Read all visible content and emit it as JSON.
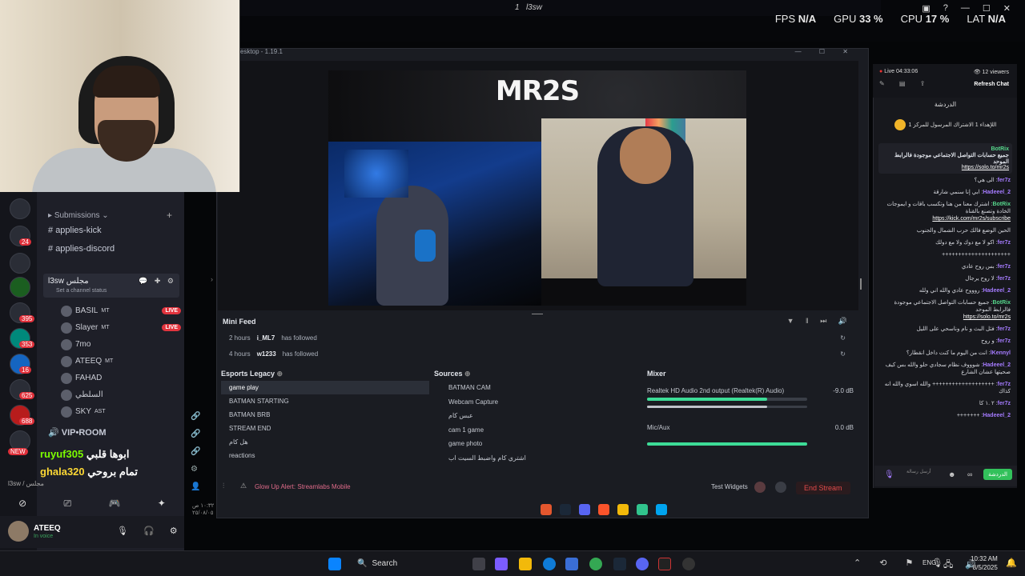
{
  "topbar": {
    "title": "l3sw",
    "tab_num": "1",
    "stats": {
      "fps_label": "FPS",
      "fps_value": "N/A",
      "gpu_label": "GPU",
      "gpu_value": "33 %",
      "cpu_label": "CPU",
      "cpu_value": "17 %",
      "lat_label": "LAT",
      "lat_value": "N/A"
    }
  },
  "discord": {
    "server_badges": [
      "24",
      "395",
      "353",
      "16",
      "625",
      "688",
      "NEW"
    ],
    "category": "Submissions",
    "channels": [
      "applies-kick",
      "applies-discord"
    ],
    "voice_channel": {
      "name": "l3sw مجلس",
      "status": "Set a channel status"
    },
    "voice_users": [
      {
        "name": "BASIL",
        "tag": "MT",
        "live": "LIVE"
      },
      {
        "name": "Slayer",
        "tag": "MT",
        "live": "LIVE"
      },
      {
        "name": "7mo",
        "tag": "",
        "live": ""
      },
      {
        "name": "ATEEQ",
        "tag": "MT",
        "live": ""
      },
      {
        "name": "FAHAD",
        "tag": "",
        "live": ""
      },
      {
        "name": "السلطي",
        "tag": "",
        "live": ""
      },
      {
        "name": "SKY",
        "tag": "AST",
        "live": ""
      }
    ],
    "vip_room": "VIP•ROOM",
    "voice_connected": "l3sw / مجلس",
    "user": {
      "name": "ATEEQ",
      "status": "In voice"
    }
  },
  "stream_overlay_chat": [
    {
      "name": "ruyuf305",
      "text": "ابوها قلبي"
    },
    {
      "name": "ghala320",
      "text": "تمام بروحي"
    }
  ],
  "streamlabs": {
    "window_title": "esktop - 1.19.1",
    "preview_title": "MR2S",
    "mini_feed": {
      "title": "Mini Feed",
      "rows": [
        {
          "time": "2 hours",
          "user": "i_ML7",
          "action": "has followed"
        },
        {
          "time": "4 hours",
          "user": "w1233",
          "action": "has followed"
        }
      ]
    },
    "scenes": {
      "title": "Esports Legacy",
      "items": [
        "game play",
        "BATMAN STARTING",
        "BATMAN BRB",
        "STREAM END",
        "هل كام",
        "reactions"
      ]
    },
    "sources": {
      "title": "Sources",
      "items": [
        "BATMAN CAM",
        "Webcam Capture",
        "عبس كام",
        "cam 1 game",
        "game photo",
        "اشتري كام واضبط السيت اب"
      ]
    },
    "mixer": {
      "title": "Mixer",
      "channels": [
        {
          "name": "Realtek HD Audio 2nd output (Realtek(R) Audio)",
          "db": "-9.0 dB",
          "level": 0.75
        },
        {
          "name": "Mic/Aux",
          "db": "0.0 dB",
          "level": 1.0
        }
      ]
    },
    "footer_alert": "Glow Up Alert: Streamlabs Mobile",
    "test_widgets": "Test Widgets",
    "end_stream": "End Stream"
  },
  "chat": {
    "live": "Live 04:33:06",
    "viewers": "12 viewers",
    "refresh": "Refresh Chat",
    "header": "الدردشة",
    "pinned_note": "اللإهداء 1 الاشتراك المرسول للمركز 1",
    "pinned": {
      "name": "BotRix",
      "text": "جميع حسابات التواصل الاجتماعي موجودة فالرابط الموحد",
      "link": "https://solo.to/mr2s"
    },
    "messages": [
      {
        "name": "fer7z",
        "text": "الى هي؟"
      },
      {
        "name": "Hadeeel_2",
        "text": "ابي إنا سنمي شارقة"
      },
      {
        "name": "BotRix",
        "text": "اشترك معنا من هنا وتكسب باقات و ايموجات الخادة وتصنع بالقناة",
        "link": "https://kick.com/mr2s/subscribe"
      },
      {
        "name": "",
        "text": "الحين الوضع فالك حرب الشمال والجنوب"
      },
      {
        "name": "fer7z",
        "text": "اكو لا مع دوك ولا مع دولك"
      },
      {
        "name": "",
        "text": "+++++++++++++++++++++"
      },
      {
        "name": "fer7z",
        "text": "بس روح عادي"
      },
      {
        "name": "fer7z",
        "text": "لا روح يرجال"
      },
      {
        "name": "Hadeeel_2",
        "text": "روووح عادي والله اني ولله"
      },
      {
        "name": "BotRix",
        "text": "جميع حسابات التواصل الاجتماعي موجودة فالرابط الموحد",
        "link": "https://solo.to/mr2s"
      },
      {
        "name": "fer7z",
        "text": "فثل البث و نام وناسحي على الليل"
      },
      {
        "name": "fer7z",
        "text": "و روح"
      },
      {
        "name": "lKennyl",
        "text": "انت من اليوم ما كنت داخل انقطار؟"
      },
      {
        "name": "Hadeeel_2",
        "text": "شوووف نظام سجادي حلو والله بس كيف صحيتها عشان الشارع"
      },
      {
        "name": "fer7z",
        "text": "+++++++++++++++++++ والله اسوي والله انه كذاك"
      },
      {
        "name": "fer7z",
        "text": "٢ .١ كا"
      },
      {
        "name": "Hadeeel_2",
        "text": "+++++++"
      }
    ],
    "send_placeholder": "أرسل رسالة",
    "send_button": "الدردشة"
  },
  "taskbar": {
    "search": "Search",
    "lang": "ENG",
    "time": "10:32 AM",
    "date": "8/5/2025"
  },
  "desk_date": {
    "line1": "١٠:٣٢ ص",
    "line2": "٢٥/٠٨/٠٥"
  }
}
